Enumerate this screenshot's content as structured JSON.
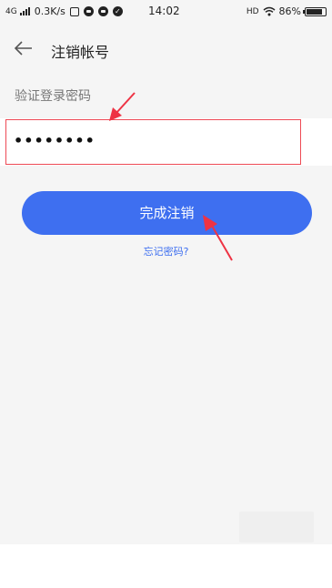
{
  "status_bar": {
    "network": "4G",
    "speed": "0.3K/s",
    "time": "14:02",
    "hd": "HD",
    "battery": "86%",
    "battery_level": 0.86
  },
  "header": {
    "back_icon": "arrow-left-icon",
    "title": "注销帐号"
  },
  "form": {
    "password_label": "验证登录密码",
    "password_value": "••••••••",
    "submit_label": "完成注销",
    "forgot_link": "忘记密码?"
  },
  "colors": {
    "accent": "#3e6ff0",
    "highlight_border": "#ee4a55",
    "annotation_arrow": "#ee3344",
    "background": "#f5f5f5"
  }
}
